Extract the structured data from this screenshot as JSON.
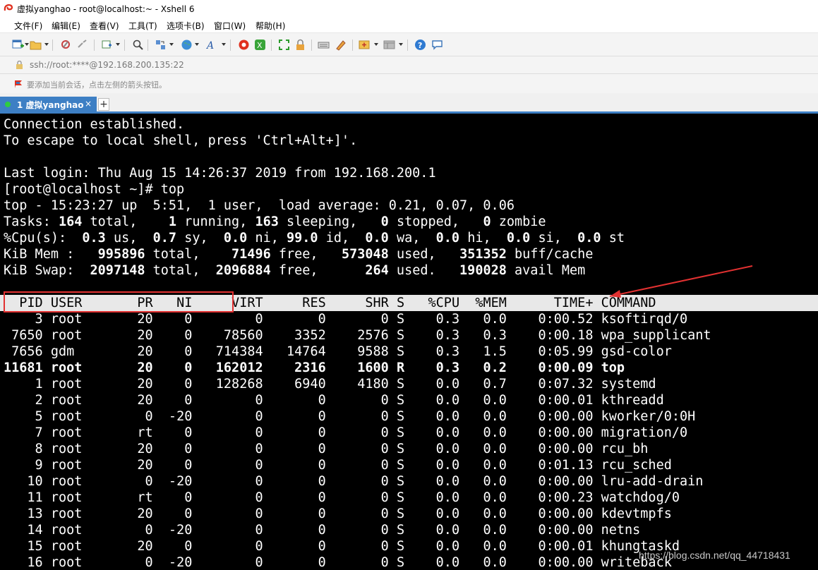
{
  "window": {
    "title": "虚拟yanghao - root@localhost:~ - Xshell 6"
  },
  "menu": [
    "文件(F)",
    "编辑(E)",
    "查看(V)",
    "工具(T)",
    "选项卡(B)",
    "窗口(W)",
    "帮助(H)"
  ],
  "address": "ssh://root:****@192.168.200.135:22",
  "session_hint": "要添加当前会话，点击左侧的箭头按钮。",
  "tab": {
    "label": "1 虚拟yanghao",
    "close": "×",
    "new_tab": "+"
  },
  "terminal": {
    "intro": [
      "Connection established.",
      "To escape to local shell, press 'Ctrl+Alt+]'.",
      "",
      "Last login: Thu Aug 15 14:26:37 2019 from 192.168.200.1",
      "[root@localhost ~]# top",
      "top - 15:23:27 up  5:51,  1 user,  load average: 0.21, 0.07, 0.06"
    ],
    "summary": {
      "tasks": {
        "label": "Tasks:",
        "total": "164",
        "running": "1",
        "sleeping": "163",
        "stopped": "0",
        "zombie": "0"
      },
      "cpu": {
        "label": "%Cpu(s):",
        "us": "0.3",
        "sy": "0.7",
        "ni": "0.0",
        "id": "99.0",
        "wa": "0.0",
        "hi": "0.0",
        "si": "0.0",
        "st": "0.0"
      },
      "mem": {
        "label": "KiB Mem :",
        "total": "995896",
        "free": "71496",
        "used": "573048",
        "buff_cache": "351352"
      },
      "swap": {
        "label": "KiB Swap:",
        "total": "2097148",
        "free": "2096884",
        "used": "264",
        "avail": "190028"
      }
    },
    "columns": [
      "PID",
      "USER",
      "PR",
      "NI",
      "VIRT",
      "RES",
      "SHR",
      "S",
      "%CPU",
      "%MEM",
      "TIME+",
      "COMMAND"
    ],
    "processes": [
      [
        "3",
        "root",
        "20",
        "0",
        "0",
        "0",
        "0",
        "S",
        "0.3",
        "0.0",
        "0:00.52",
        "ksoftirqd/0"
      ],
      [
        "7650",
        "root",
        "20",
        "0",
        "78560",
        "3352",
        "2576",
        "S",
        "0.3",
        "0.3",
        "0:00.18",
        "wpa_supplicant"
      ],
      [
        "7656",
        "gdm",
        "20",
        "0",
        "714384",
        "14764",
        "9588",
        "S",
        "0.3",
        "1.5",
        "0:05.99",
        "gsd-color"
      ],
      [
        "11681",
        "root",
        "20",
        "0",
        "162012",
        "2316",
        "1600",
        "R",
        "0.3",
        "0.2",
        "0:00.09",
        "top"
      ],
      [
        "1",
        "root",
        "20",
        "0",
        "128268",
        "6940",
        "4180",
        "S",
        "0.0",
        "0.7",
        "0:07.32",
        "systemd"
      ],
      [
        "2",
        "root",
        "20",
        "0",
        "0",
        "0",
        "0",
        "S",
        "0.0",
        "0.0",
        "0:00.01",
        "kthreadd"
      ],
      [
        "5",
        "root",
        "0",
        "-20",
        "0",
        "0",
        "0",
        "S",
        "0.0",
        "0.0",
        "0:00.00",
        "kworker/0:0H"
      ],
      [
        "7",
        "root",
        "rt",
        "0",
        "0",
        "0",
        "0",
        "S",
        "0.0",
        "0.0",
        "0:00.00",
        "migration/0"
      ],
      [
        "8",
        "root",
        "20",
        "0",
        "0",
        "0",
        "0",
        "S",
        "0.0",
        "0.0",
        "0:00.00",
        "rcu_bh"
      ],
      [
        "9",
        "root",
        "20",
        "0",
        "0",
        "0",
        "0",
        "S",
        "0.0",
        "0.0",
        "0:01.13",
        "rcu_sched"
      ],
      [
        "10",
        "root",
        "0",
        "-20",
        "0",
        "0",
        "0",
        "S",
        "0.0",
        "0.0",
        "0:00.00",
        "lru-add-drain"
      ],
      [
        "11",
        "root",
        "rt",
        "0",
        "0",
        "0",
        "0",
        "S",
        "0.0",
        "0.0",
        "0:00.23",
        "watchdog/0"
      ],
      [
        "13",
        "root",
        "20",
        "0",
        "0",
        "0",
        "0",
        "S",
        "0.0",
        "0.0",
        "0:00.00",
        "kdevtmpfs"
      ],
      [
        "14",
        "root",
        "0",
        "-20",
        "0",
        "0",
        "0",
        "S",
        "0.0",
        "0.0",
        "0:00.00",
        "netns"
      ],
      [
        "15",
        "root",
        "20",
        "0",
        "0",
        "0",
        "0",
        "S",
        "0.0",
        "0.0",
        "0:00.01",
        "khungtaskd"
      ],
      [
        "16",
        "root",
        "0",
        "-20",
        "0",
        "0",
        "0",
        "S",
        "0.0",
        "0.0",
        "0:00.00",
        "writeback"
      ]
    ]
  },
  "watermark": "https://blog.csdn.net/qq_44718431",
  "icons": [
    "new-session-icon",
    "open-folder-icon",
    "reconnect-icon",
    "disconnect-icon",
    "properties-icon",
    "search-icon",
    "transfer-icon",
    "globe-icon",
    "font-icon",
    "xftp-icon",
    "xmanager-icon",
    "fullscreen-icon",
    "lock-icon",
    "keyboard-icon",
    "script-icon",
    "compose-icon",
    "layout-icon",
    "help-icon",
    "chat-icon"
  ],
  "colors": {
    "annotation": "#e23131",
    "tab_active": "#3d7fc4"
  }
}
